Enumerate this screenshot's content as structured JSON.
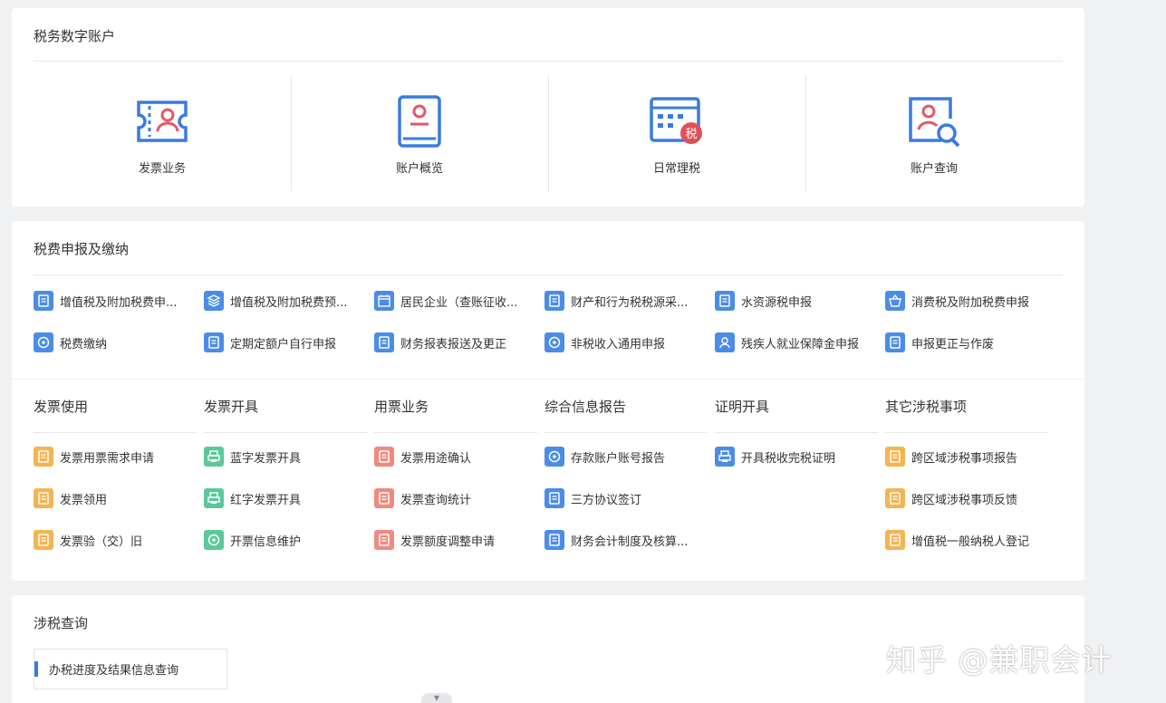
{
  "account": {
    "title": "税务数字账户",
    "items": [
      {
        "label": "发票业务",
        "icon": "invoice-ticket-icon"
      },
      {
        "label": "账户概览",
        "icon": "account-book-icon"
      },
      {
        "label": "日常理税",
        "icon": "tax-calendar-icon",
        "badge": "税"
      },
      {
        "label": "账户查询",
        "icon": "account-search-icon"
      }
    ]
  },
  "declaration": {
    "title": "税费申报及缴纳",
    "items": [
      {
        "label": "增值税及附加税费申...",
        "icon": "form-icon"
      },
      {
        "label": "增值税及附加税费预...",
        "icon": "layers-icon"
      },
      {
        "label": "居民企业（查账征收...",
        "icon": "calendar-icon"
      },
      {
        "label": "财产和行为税税源采...",
        "icon": "edit-doc-icon"
      },
      {
        "label": "水资源税申报",
        "icon": "water-edit-icon"
      },
      {
        "label": "消费税及附加税费申报",
        "icon": "basket-icon"
      },
      {
        "label": "税费缴纳",
        "icon": "payment-icon"
      },
      {
        "label": "定期定额户自行申报",
        "icon": "regular-doc-icon"
      },
      {
        "label": "财务报表报送及更正",
        "icon": "report-icon"
      },
      {
        "label": "非税收入通用申报",
        "icon": "medal-icon"
      },
      {
        "label": "残疾人就业保障金申报",
        "icon": "wheelchair-icon"
      },
      {
        "label": "申报更正与作废",
        "icon": "correct-doc-icon"
      }
    ]
  },
  "categories": [
    {
      "head": "发票使用",
      "items": [
        {
          "label": "发票用票需求申请",
          "icon": "ticket-icon",
          "color": "#f5b452"
        },
        {
          "label": "发票领用",
          "icon": "ticket-receive-icon",
          "color": "#f5b452"
        },
        {
          "label": "发票验（交）旧",
          "icon": "ticket-check-icon",
          "color": "#f5b452"
        }
      ]
    },
    {
      "head": "发票开具",
      "items": [
        {
          "label": "蓝字发票开具",
          "icon": "printer-icon",
          "color": "#5cc79b"
        },
        {
          "label": "红字发票开具",
          "icon": "printer-icon",
          "color": "#5cc79b"
        },
        {
          "label": "开票信息维护",
          "icon": "maintain-icon",
          "color": "#5cc79b"
        }
      ]
    },
    {
      "head": "用票业务",
      "items": [
        {
          "label": "发票用途确认",
          "icon": "confirm-doc-icon",
          "color": "#f08a7e"
        },
        {
          "label": "发票查询统计",
          "icon": "stats-doc-icon",
          "color": "#f08a7e"
        },
        {
          "label": "发票额度调整申请",
          "icon": "quota-doc-icon",
          "color": "#f08a7e"
        }
      ]
    },
    {
      "head": "综合信息报告",
      "items": [
        {
          "label": "存款账户账号报告",
          "icon": "deposit-icon",
          "color": "#4a8ce8"
        },
        {
          "label": "三方协议签订",
          "icon": "agreement-icon",
          "color": "#4a8ce8"
        },
        {
          "label": "财务会计制度及核算...",
          "icon": "accounting-icon",
          "color": "#4a8ce8"
        }
      ]
    },
    {
      "head": "证明开具",
      "items": [
        {
          "label": "开具税收完税证明",
          "icon": "certificate-print-icon",
          "color": "#4a8ce8"
        }
      ]
    },
    {
      "head": "其它涉税事项",
      "items": [
        {
          "label": "跨区域涉税事项报告",
          "icon": "cross-region-report-icon",
          "color": "#f5b452"
        },
        {
          "label": "跨区域涉税事项反馈",
          "icon": "cross-region-feedback-icon",
          "color": "#f5b452"
        },
        {
          "label": "增值税一般纳税人登记",
          "icon": "register-icon",
          "color": "#f5b452"
        }
      ]
    }
  ],
  "query": {
    "title": "涉税查询",
    "item": "办税进度及结果信息查询"
  },
  "watermark": "知乎 @兼职会计",
  "colors": {
    "accent": "#3a7be0",
    "blue": "#4a8ce8",
    "orange": "#f5b452",
    "green": "#5cc79b",
    "red": "#f08a7e"
  }
}
